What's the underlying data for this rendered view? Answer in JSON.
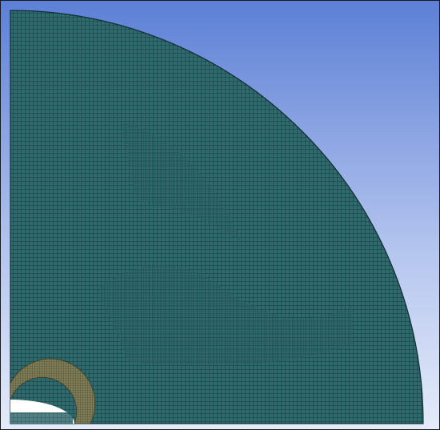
{
  "viewport": {
    "background_top": "#5c80d6",
    "background_bottom": "#e4ebf9"
  },
  "mesh": {
    "region_color": "#2f6a6e",
    "grid_line_color": "#0f2e32",
    "inner_ring_color": "#7f7e58",
    "hole_color": "#ffffff"
  }
}
